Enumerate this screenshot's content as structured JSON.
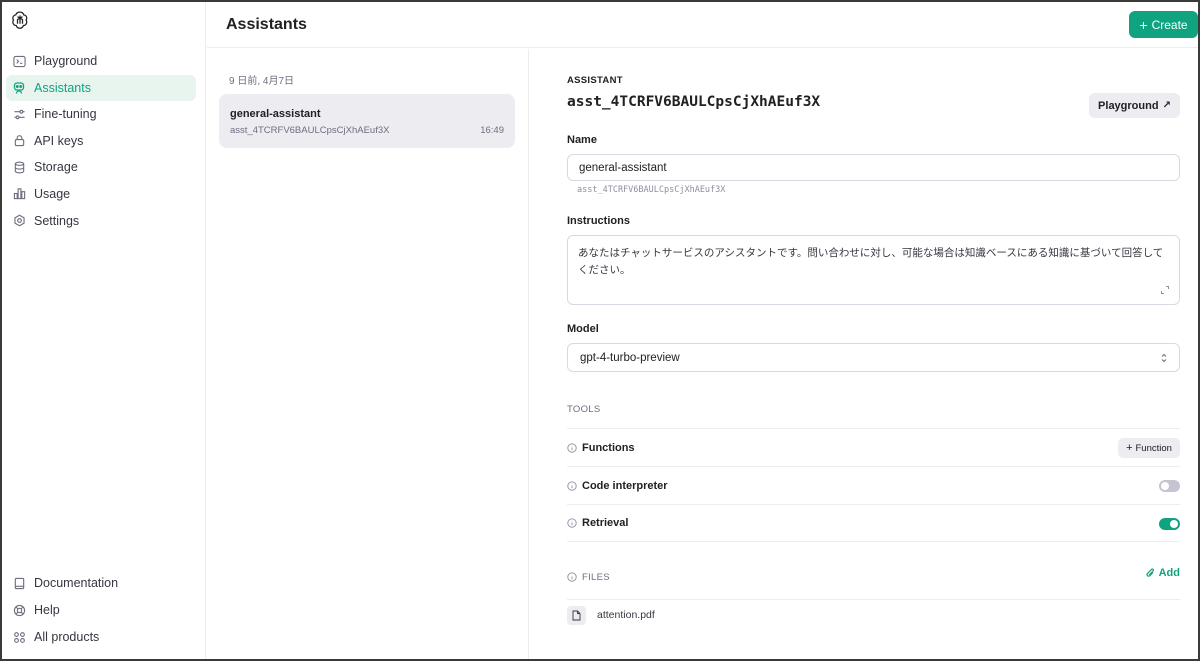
{
  "sidebar": {
    "items": [
      {
        "label": "Playground"
      },
      {
        "label": "Assistants"
      },
      {
        "label": "Fine-tuning"
      },
      {
        "label": "API keys"
      },
      {
        "label": "Storage"
      },
      {
        "label": "Usage"
      },
      {
        "label": "Settings"
      }
    ],
    "active_index": 1,
    "bottom_items": [
      {
        "label": "Documentation"
      },
      {
        "label": "Help"
      },
      {
        "label": "All products"
      }
    ]
  },
  "header": {
    "title": "Assistants",
    "create_label": "Create"
  },
  "list": {
    "date_group": "9 日前, 4月7日",
    "items": [
      {
        "name": "general-assistant",
        "id": "asst_4TCRFV6BAULCpsCjXhAEuf3X",
        "time": "16:49"
      }
    ]
  },
  "detail": {
    "overline": "ASSISTANT",
    "id": "asst_4TCRFV6BAULCpsCjXhAEuf3X",
    "playground_button": "Playground",
    "name_label": "Name",
    "name_value": "general-assistant",
    "name_sub": "asst_4TCRFV6BAULCpsCjXhAEuf3X",
    "instructions_label": "Instructions",
    "instructions_value": "あなたはチャットサービスのアシスタントです。問い合わせに対し、可能な場合は知識ベースにある知識に基づいて回答してください。",
    "model_label": "Model",
    "model_value": "gpt-4-turbo-preview",
    "tools_label": "TOOLS",
    "tools": [
      {
        "label": "Functions",
        "action": "Function"
      },
      {
        "label": "Code interpreter",
        "enabled": false
      },
      {
        "label": "Retrieval",
        "enabled": true
      }
    ],
    "files_label": "FILES",
    "add_label": "Add",
    "files": [
      {
        "name": "attention.pdf"
      }
    ]
  },
  "colors": {
    "accent": "#10a37f",
    "active_bg": "#e8f5ef",
    "muted": "#6e6e80",
    "surface": "#ececf1"
  }
}
